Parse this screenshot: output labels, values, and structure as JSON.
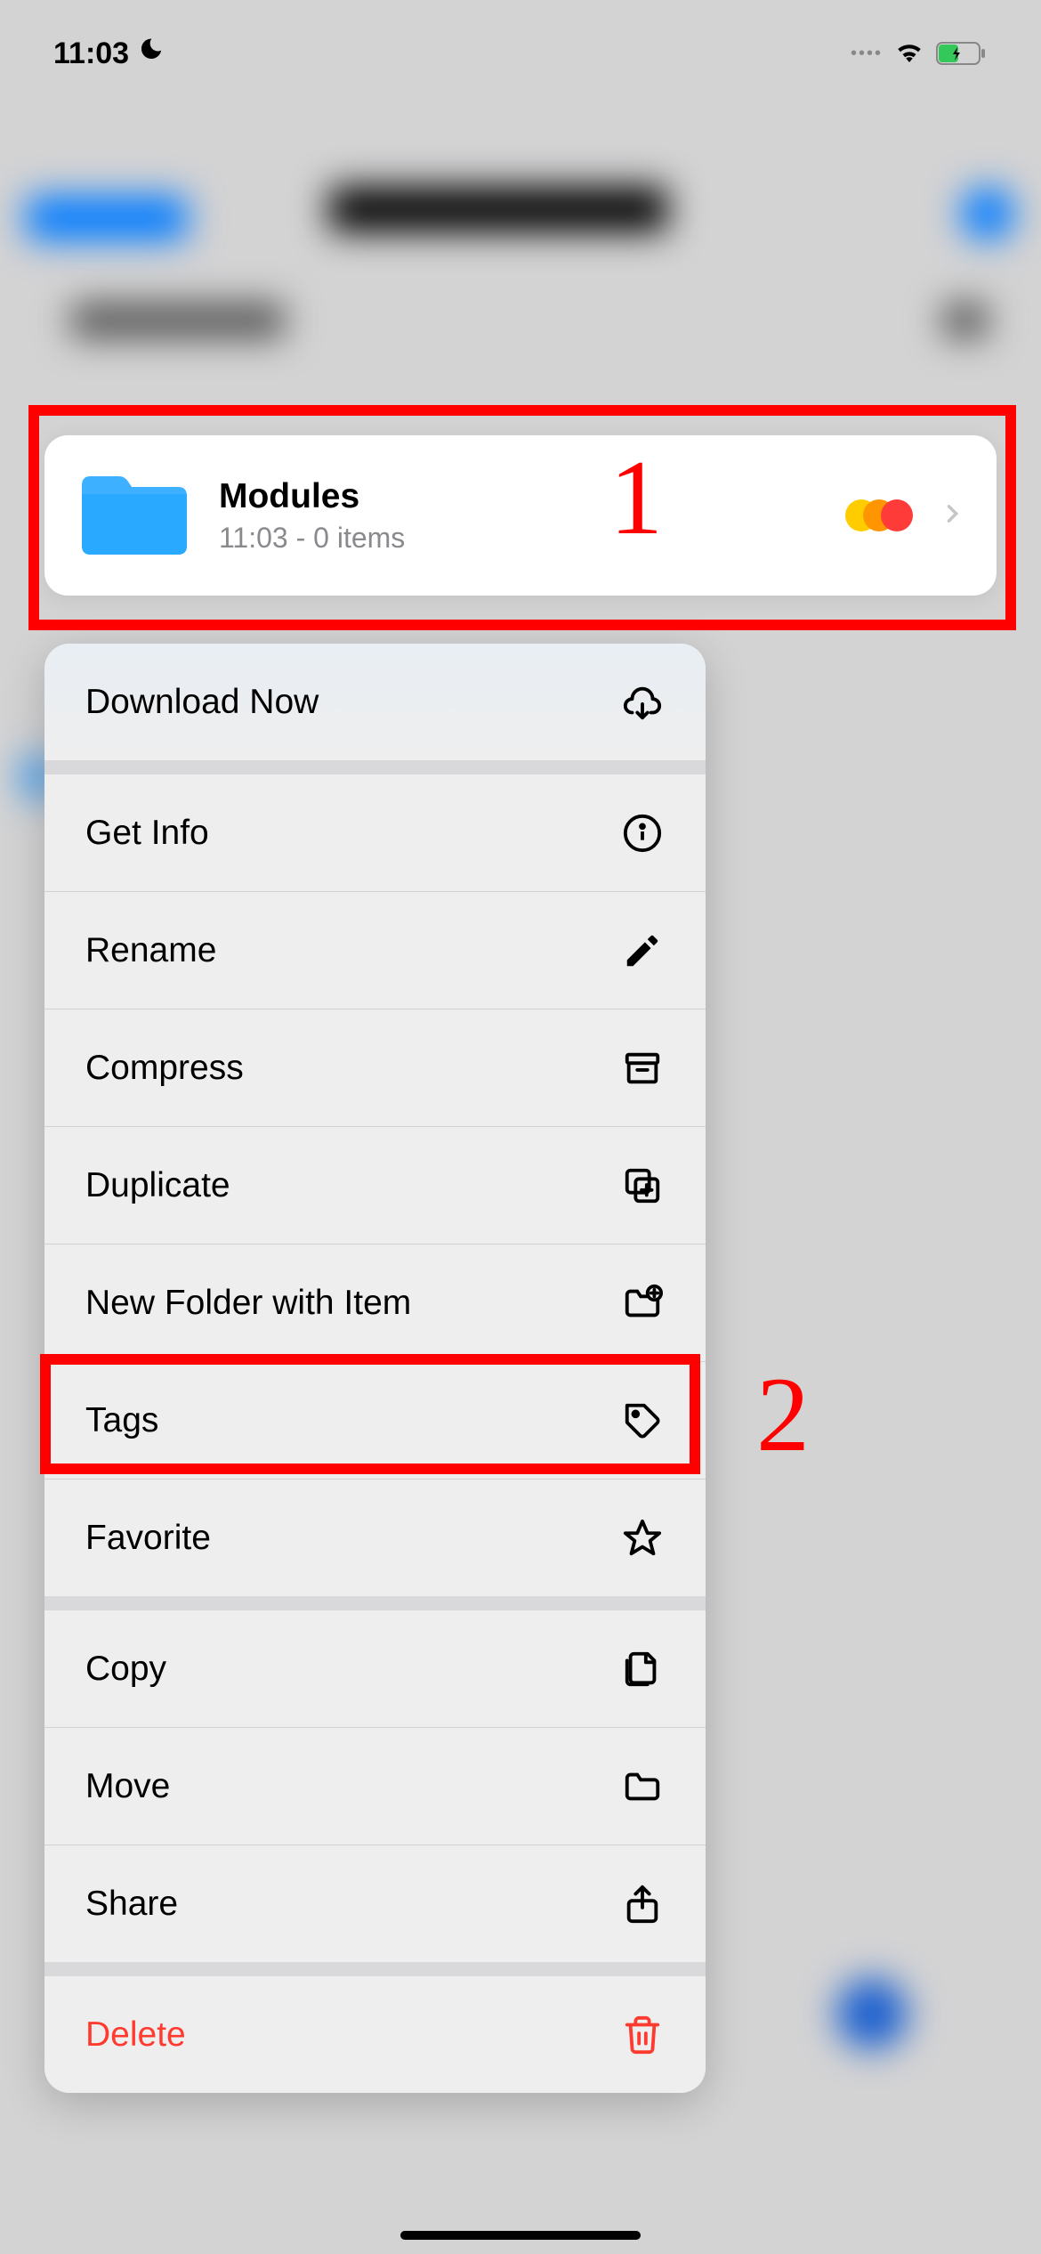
{
  "status": {
    "time": "11:03",
    "moon": "☾"
  },
  "folder": {
    "name": "Modules",
    "meta": "11:03 - 0 items"
  },
  "annotations": {
    "label1": "1",
    "label2": "2"
  },
  "menu": {
    "download": "Download Now",
    "getInfo": "Get Info",
    "rename": "Rename",
    "compress": "Compress",
    "duplicate": "Duplicate",
    "newFolder": "New Folder with Item",
    "tags": "Tags",
    "favorite": "Favorite",
    "copy": "Copy",
    "move": "Move",
    "share": "Share",
    "delete": "Delete"
  }
}
